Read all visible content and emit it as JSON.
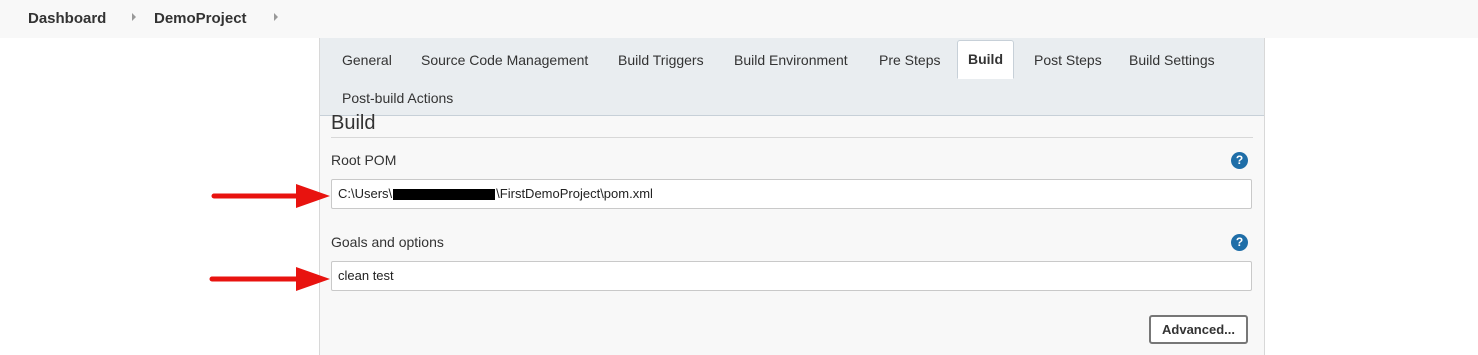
{
  "breadcrumb": {
    "items": [
      "Dashboard",
      "DemoProject"
    ]
  },
  "tabs": [
    {
      "label": "General"
    },
    {
      "label": "Source Code Management"
    },
    {
      "label": "Build Triggers"
    },
    {
      "label": "Build Environment"
    },
    {
      "label": "Pre Steps"
    },
    {
      "label": "Build",
      "active": true
    },
    {
      "label": "Post Steps"
    },
    {
      "label": "Build Settings"
    },
    {
      "label": "Post-build Actions"
    }
  ],
  "build": {
    "title": "Build",
    "root_pom": {
      "label": "Root POM",
      "value_prefix": "C:\\Users\\",
      "value_suffix": "\\FirstDemoProject\\pom.xml",
      "redacted": true
    },
    "goals": {
      "label": "Goals and options",
      "value": "clean test"
    },
    "help_glyph": "?",
    "advanced_label": "Advanced..."
  },
  "colors": {
    "tab_bar": "#e9edf0",
    "help_icon": "#1f6ea8",
    "annotation_arrow": "#e8130f"
  },
  "icons": {
    "breadcrumb_separator": "chevron-right-icon",
    "help": "help-icon",
    "annotation": "red-arrow-icon"
  }
}
